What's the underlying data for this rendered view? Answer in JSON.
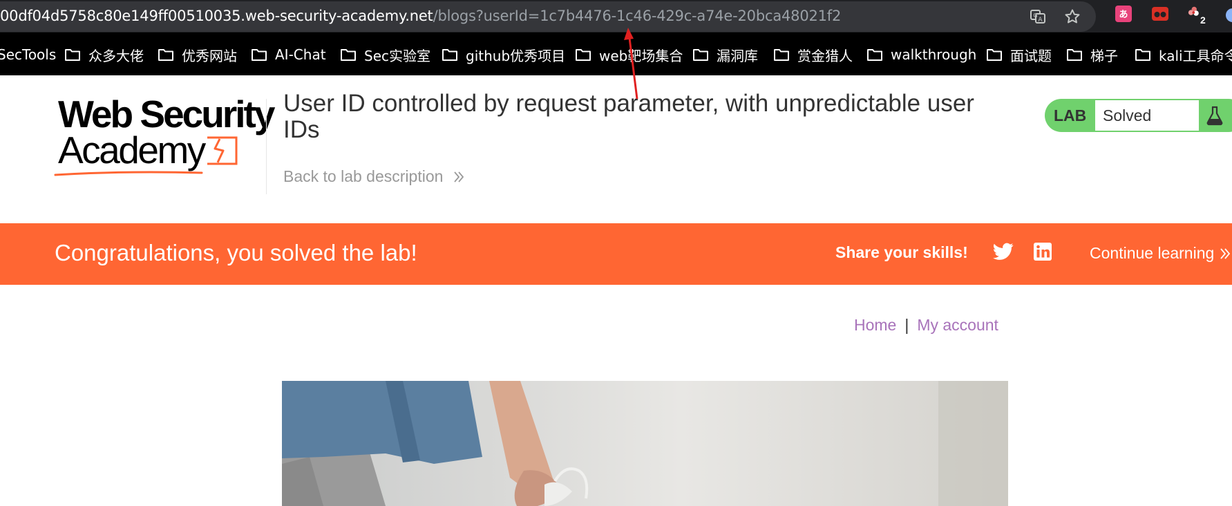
{
  "browser": {
    "url_host": "00df04d5758c80e149ff00510035.web-security-academy.net",
    "url_path": "/blogs?userId=1c7b4476-1c46-429c-a74e-20bca48021f2",
    "extension_badge": "2"
  },
  "bookmarks": [
    {
      "label": "SecTools"
    },
    {
      "label": "众多大佬"
    },
    {
      "label": "优秀网站"
    },
    {
      "label": "AI-Chat"
    },
    {
      "label": "Sec实验室"
    },
    {
      "label": "github优秀项目"
    },
    {
      "label": "web靶场集合"
    },
    {
      "label": "漏洞库"
    },
    {
      "label": "赏金猎人"
    },
    {
      "label": "walkthrough"
    },
    {
      "label": "面试题"
    },
    {
      "label": "梯子"
    },
    {
      "label": "kali工具命令"
    }
  ],
  "lab": {
    "logo_line1": "Web Security",
    "logo_line2": "Academy",
    "title": "User ID controlled by request parameter, with unpredictable user IDs",
    "back_link": "Back to lab description",
    "status_label": "LAB",
    "status_value": "Solved"
  },
  "banner": {
    "message": "Congratulations, you solved the lab!",
    "share_label": "Share your skills!",
    "continue_label": "Continue learning"
  },
  "nav": {
    "home": "Home",
    "separator": "|",
    "my_account": "My account"
  },
  "colors": {
    "accent_orange": "#ff6633",
    "lab_green": "#70d16d",
    "link_purple": "#a873ba"
  }
}
